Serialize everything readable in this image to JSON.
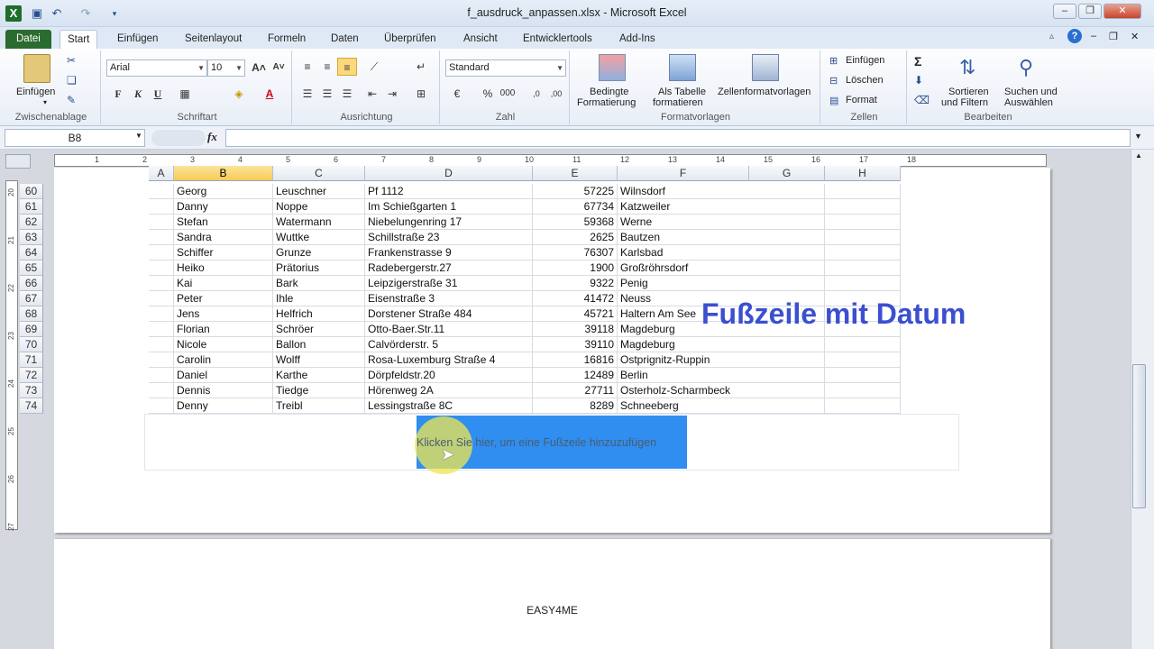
{
  "window": {
    "title": "f_ausdruck_anpassen.xlsx - Microsoft Excel"
  },
  "tabs": [
    "Datei",
    "Start",
    "Einfügen",
    "Seitenlayout",
    "Formeln",
    "Daten",
    "Überprüfen",
    "Ansicht",
    "Entwicklertools",
    "Add-Ins"
  ],
  "ribbon": {
    "clipboard": {
      "paste": "Einfügen",
      "label": "Zwischenablage"
    },
    "font": {
      "name": "Arial",
      "size": "10",
      "bold": "F",
      "italic": "K",
      "underline": "U",
      "label": "Schriftart"
    },
    "alignment": {
      "label": "Ausrichtung"
    },
    "number": {
      "format": "Standard",
      "percent": "%",
      "thousands": "000",
      "label": "Zahl"
    },
    "styles": {
      "conditional1": "Bedingte",
      "conditional2": "Formatierung",
      "table1": "Als Tabelle",
      "table2": "formatieren",
      "cellstyles": "Zellenformatvorlagen",
      "label": "Formatvorlagen"
    },
    "cells": {
      "insert": "Einfügen",
      "delete": "Löschen",
      "format": "Format",
      "label": "Zellen"
    },
    "editing": {
      "sort1": "Sortieren",
      "sort2": "und Filtern",
      "find1": "Suchen und",
      "find2": "Auswählen",
      "label": "Bearbeiten"
    }
  },
  "formula": {
    "namebox": "B8",
    "fx": "fx"
  },
  "columns": [
    "A",
    "B",
    "C",
    "D",
    "E",
    "F",
    "G",
    "H"
  ],
  "rows": [
    {
      "n": "60",
      "b": "Georg",
      "c": "Leuschner",
      "d": "Pf 1112",
      "e": "57225",
      "f": "Wilnsdorf"
    },
    {
      "n": "61",
      "b": "Danny",
      "c": "Noppe",
      "d": "Im Schießgarten 1",
      "e": "67734",
      "f": "Katzweiler"
    },
    {
      "n": "62",
      "b": "Stefan",
      "c": "Watermann",
      "d": "Niebelungenring 17",
      "e": "59368",
      "f": "Werne"
    },
    {
      "n": "63",
      "b": "Sandra",
      "c": "Wuttke",
      "d": "Schillstraße 23",
      "e": "2625",
      "f": "Bautzen"
    },
    {
      "n": "64",
      "b": "Schiffer",
      "c": "Grunze",
      "d": "Frankenstrasse 9",
      "e": "76307",
      "f": "Karlsbad"
    },
    {
      "n": "65",
      "b": "Heiko",
      "c": "Prätorius",
      "d": "Radebergerstr.27",
      "e": "1900",
      "f": "Großröhrsdorf"
    },
    {
      "n": "66",
      "b": "Kai",
      "c": "Bark",
      "d": "Leipzigerstraße 31",
      "e": "9322",
      "f": "Penig"
    },
    {
      "n": "67",
      "b": "Peter",
      "c": "Ihle",
      "d": "Eisenstraße 3",
      "e": "41472",
      "f": "Neuss"
    },
    {
      "n": "68",
      "b": "Jens",
      "c": "Helfrich",
      "d": "Dorstener Straße 484",
      "e": "45721",
      "f": "Haltern Am See"
    },
    {
      "n": "69",
      "b": "Florian",
      "c": "Schröer",
      "d": "Otto-Baer.Str.11",
      "e": "39118",
      "f": "Magdeburg"
    },
    {
      "n": "70",
      "b": "Nicole",
      "c": "Ballon",
      "d": "Calvörderstr. 5",
      "e": "39110",
      "f": "Magdeburg"
    },
    {
      "n": "71",
      "b": "Carolin",
      "c": "Wolff",
      "d": "Rosa-Luxemburg Straße 4",
      "e": "16816",
      "f": "Ostprignitz-Ruppin"
    },
    {
      "n": "72",
      "b": "Daniel",
      "c": "Karthe",
      "d": "Dörpfeldstr.20",
      "e": "12489",
      "f": "Berlin"
    },
    {
      "n": "73",
      "b": "Dennis",
      "c": "Tiedge",
      "d": "Hörenweg 2A",
      "e": "27711",
      "f": "Osterholz-Scharmbeck"
    },
    {
      "n": "74",
      "b": "Denny",
      "c": "Treibl",
      "d": "Lessingstraße 8C",
      "e": "8289",
      "f": "Schneeberg"
    }
  ],
  "footer": {
    "placeholder": "Klicken Sie hier, um eine Fußzeile hinzuzufügen"
  },
  "overlay": "Fußzeile mit Datum",
  "page2_footer": "EASY4ME",
  "ruler_top": [
    "1",
    "2",
    "3",
    "4",
    "5",
    "6",
    "7",
    "8",
    "9",
    "10",
    "11",
    "12",
    "13",
    "14",
    "15",
    "16",
    "17",
    "18"
  ],
  "ruler_left": [
    "20",
    "21",
    "22",
    "23",
    "24",
    "25",
    "26",
    "27"
  ],
  "colors": {
    "file_tab": "#2a6b2f",
    "selected_header": "#f8cb55",
    "footer_highlight": "#2f8ef0",
    "overlay_text": "#3b4fd0"
  }
}
